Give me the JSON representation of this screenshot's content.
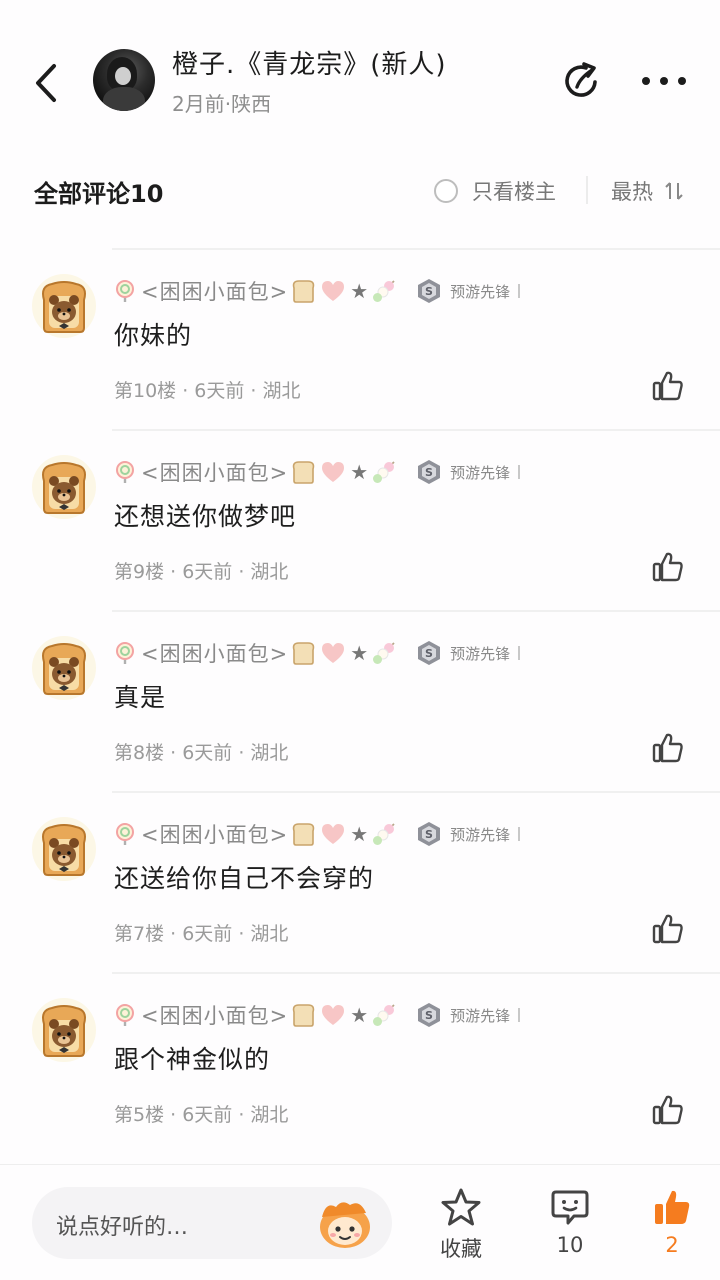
{
  "header": {
    "author_name": "橙子.《青龙宗》(新人)",
    "author_meta": "2月前·陕西"
  },
  "toolbar": {
    "all_comments_label": "全部评论10",
    "only_op_label": "只看楼主",
    "sort_label": "最热"
  },
  "comments": [
    {
      "username": "<困困小面包>",
      "badge": "预游先锋",
      "text": "你妹的",
      "meta": "第10楼 · 6天前 · 湖北"
    },
    {
      "username": "<困困小面包>",
      "badge": "预游先锋",
      "text": "还想送你做梦吧",
      "meta": "第9楼 · 6天前 · 湖北"
    },
    {
      "username": "<困困小面包>",
      "badge": "预游先锋",
      "text": "真是",
      "meta": "第8楼 · 6天前 · 湖北"
    },
    {
      "username": "<困困小面包>",
      "badge": "预游先锋",
      "text": "还送给你自己不会穿的",
      "meta": "第7楼 · 6天前 · 湖北"
    },
    {
      "username": "<困困小面包>",
      "badge": "预游先锋",
      "text": "跟个神金似的",
      "meta": "第5楼 · 6天前 · 湖北"
    }
  ],
  "bottom_bar": {
    "input_placeholder": "说点好听的…",
    "favorite_label": "收藏",
    "comment_count": "10",
    "like_count": "2"
  },
  "colors": {
    "accent": "#f57c1f",
    "text_primary": "#1e1e1e",
    "text_secondary": "#9a9a9a"
  },
  "icons": [
    "back-arrow-icon",
    "share-icon",
    "more-icon",
    "radio-icon",
    "sort-icon",
    "lollipop-icon",
    "bread-emoji-icon",
    "heart-emoji-icon",
    "star-emoji-icon",
    "dango-emoji-icon",
    "badge-icon",
    "thumbs-up-icon",
    "star-icon",
    "comment-bubble-icon",
    "mascot-icon"
  ]
}
